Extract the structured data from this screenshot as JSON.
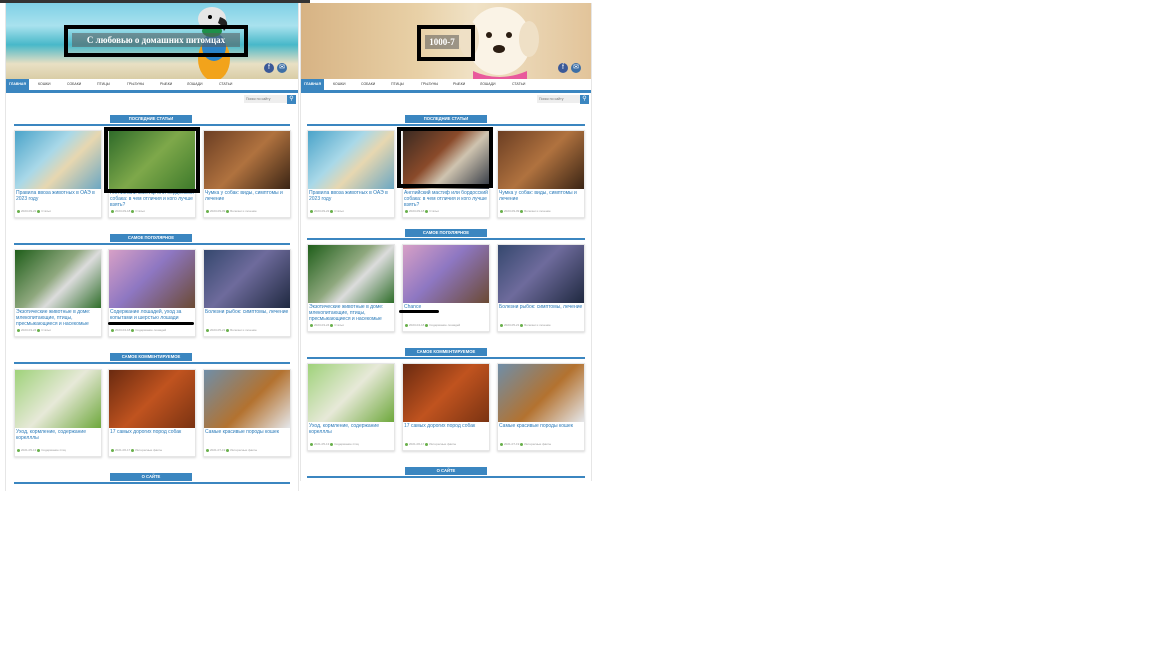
{
  "panels": [
    {
      "site_title": "С любовью о домашних питомцах",
      "nav": [
        "главная",
        "кошки",
        "собаки",
        "птицы",
        "грызуны",
        "рыбки",
        "лошади",
        "статьи"
      ],
      "search_placeholder": "Поиск по сайту",
      "sections": [
        {
          "title": "последние статьи",
          "cards": [
            {
              "title": "Правила ввоза животных в ОАЭ в 2023 году",
              "date": "2023-09-22",
              "cat": "Статьи"
            },
            {
              "title": "Английский мастиф или бордосский собака: в чем отличия и кого лучше взять?",
              "date": "2023-09-18",
              "cat": "Статьи"
            },
            {
              "title": "Чумка у собак: виды, симптомы и лечение",
              "date": "2023-09-09",
              "cat": "Болезни и лечение"
            }
          ]
        },
        {
          "title": "самое популярное",
          "cards": [
            {
              "title": "Экзотические животные в доме: млекопитающие, птицы, пресмыкающиеся и насекомые",
              "date": "2023-03-24",
              "cat": "Статьи"
            },
            {
              "title": "Содержание лошадей, уход за копытами и шерстью лошади",
              "date": "2023-04-18",
              "cat": "Содержание лошадей"
            },
            {
              "title": "Болезни рыбок: симптомы, лечение",
              "date": "2023-05-21",
              "cat": "Болезни и лечение"
            }
          ]
        },
        {
          "title": "самое комментируемое",
          "cards": [
            {
              "title": "Уход, кормление, содержание корелллы",
              "date": "2021-05-13",
              "cat": "Содержание птиц"
            },
            {
              "title": "17 самых дорогих пород собак",
              "date": "2021-06-17",
              "cat": "Интересные факты"
            },
            {
              "title": "Самые красивые породы кошек",
              "date": "2021-07-19",
              "cat": "Интересные факты"
            }
          ]
        },
        {
          "title": "о сайте",
          "cards": []
        }
      ]
    },
    {
      "site_title": "1000-7",
      "nav": [
        "главная",
        "кошки",
        "собаки",
        "птицы",
        "грызуны",
        "рыбки",
        "лошади",
        "статьи"
      ],
      "search_placeholder": "Поиск по сайту",
      "sections": [
        {
          "title": "последние статьи",
          "cards": [
            {
              "title": "Правила ввоза животных в ОАЭ в 2023 году",
              "date": "2023-09-22",
              "cat": "Статьи"
            },
            {
              "title": "Английский мастиф или бордосский собака: в чем отличия и кого лучше взять?",
              "date": "2023-09-18",
              "cat": "Статьи"
            },
            {
              "title": "Чумка у собак: виды, симптомы и лечение",
              "date": "2023-09-09",
              "cat": "Болезни и лечение"
            }
          ]
        },
        {
          "title": "самое популярное",
          "cards": [
            {
              "title": "Экзотические животные в доме: млекопитающие, птицы, пресмыкающиеся и насекомые",
              "date": "2023-03-24",
              "cat": "Статьи"
            },
            {
              "title": "Chance",
              "date": "2023-04-18",
              "cat": "Содержание лошадей"
            },
            {
              "title": "Болезни рыбок: симптомы, лечение",
              "date": "2023-05-21",
              "cat": "Болезни и лечение"
            }
          ]
        },
        {
          "title": "самое комментируемое",
          "cards": [
            {
              "title": "Уход, кормление, содержание корелллы",
              "date": "2021-05-13",
              "cat": "Содержание птиц"
            },
            {
              "title": "17 самых дорогих пород собак",
              "date": "2021-06-17",
              "cat": "Интересные факты"
            },
            {
              "title": "Самые красивые породы кошек",
              "date": "2021-07-19",
              "cat": "Интересные факты"
            }
          ]
        },
        {
          "title": "о сайте",
          "cards": []
        }
      ]
    }
  ],
  "colors": {
    "accent": "#3b86c0",
    "link": "#2b7bb9"
  }
}
